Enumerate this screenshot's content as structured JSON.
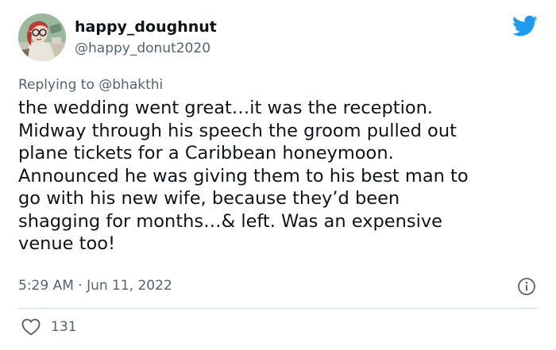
{
  "user": {
    "display_name": "happy_doughnut",
    "handle": "@happy_donut2020",
    "avatar_icon": "avatar-illustration"
  },
  "brand": {
    "icon": "twitter-bird-icon",
    "color": "#1d9bf0"
  },
  "reply": {
    "prefix": "Replying to",
    "mention": "@bhakthi"
  },
  "tweet": {
    "lines": [
      "the wedding went great…it was the reception.",
      "Midway through his speech the groom pulled out",
      "plane tickets for a Caribbean honeymoon.",
      "Announced he was giving them to his best man to",
      "go with his new wife, because they’d been",
      "shagging for months…& left. Was an expensive",
      "venue too!"
    ]
  },
  "meta": {
    "timestamp": "5:29 AM · Jun 11, 2022",
    "info_icon": "info-icon"
  },
  "actions": {
    "like_icon": "heart-icon",
    "like_count": "131"
  },
  "colors": {
    "text": "#0f1419",
    "secondary": "#536471",
    "divider": "#cfd9de"
  }
}
